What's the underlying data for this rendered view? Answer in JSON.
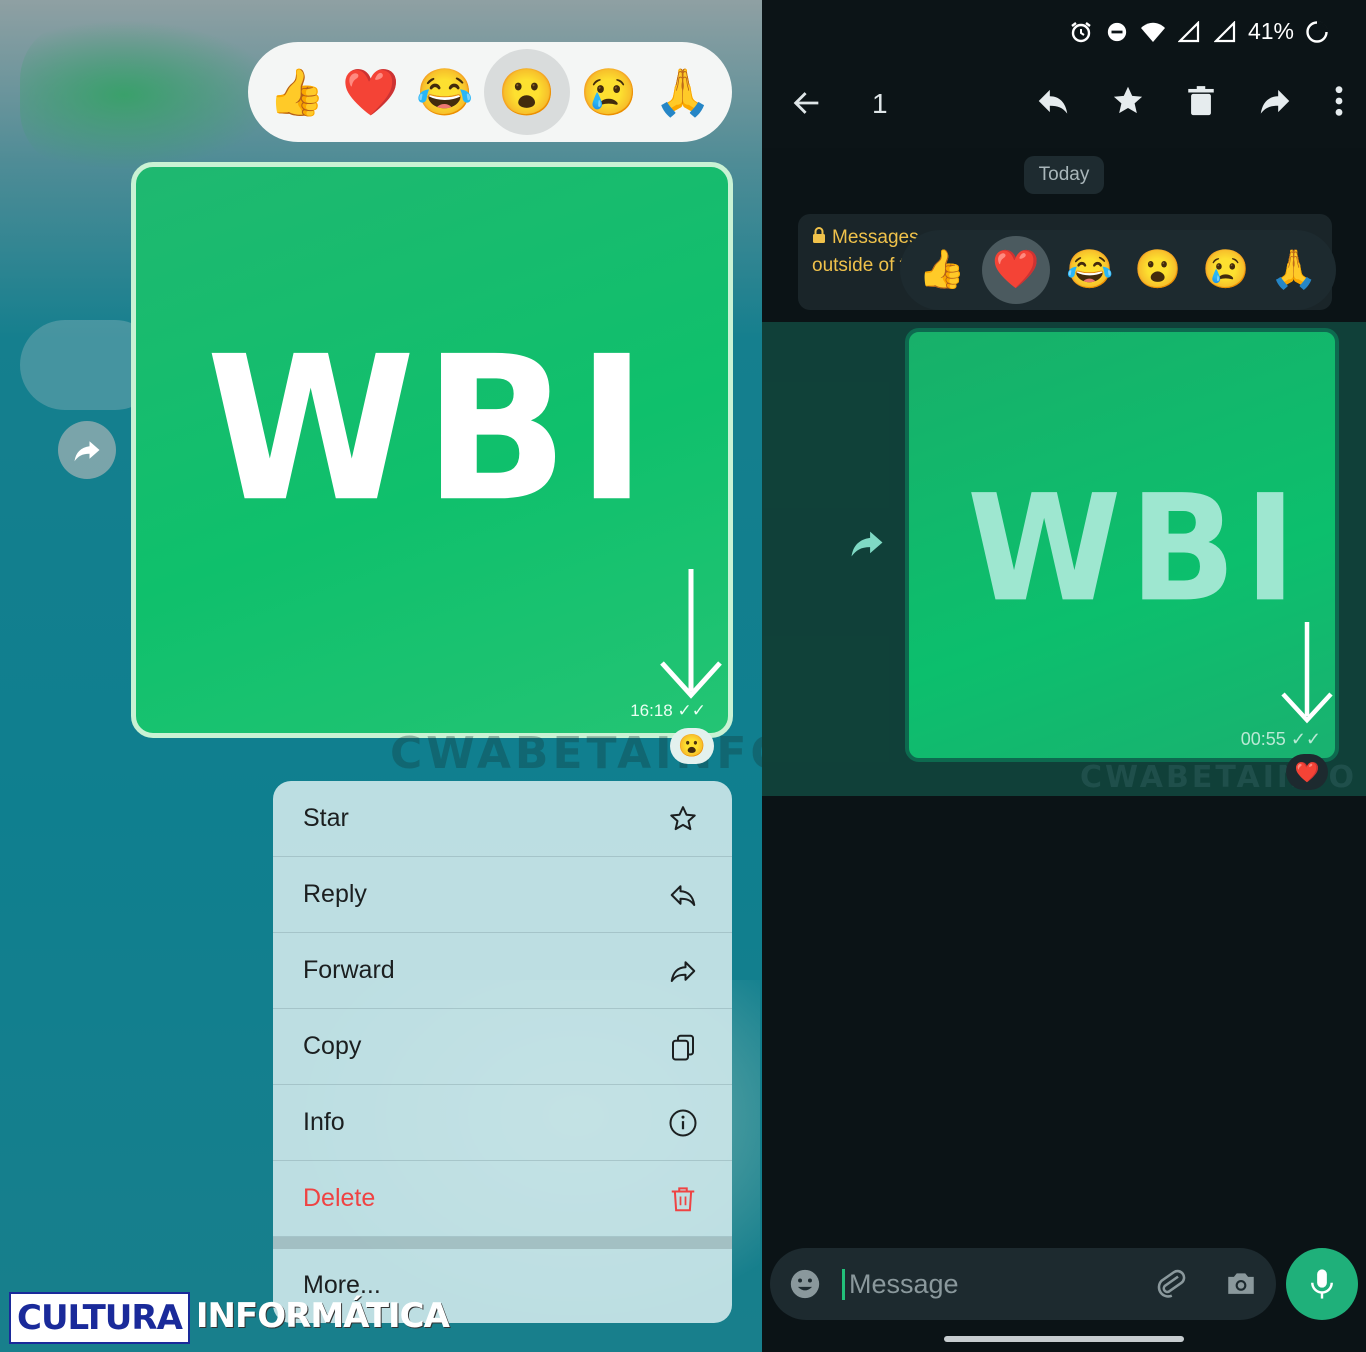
{
  "left": {
    "reactions": [
      {
        "name": "thumbs-up",
        "emoji": "👍",
        "selected": false
      },
      {
        "name": "red-heart",
        "emoji": "❤️",
        "selected": false
      },
      {
        "name": "tears-of-joy",
        "emoji": "😂",
        "selected": false
      },
      {
        "name": "surprised",
        "emoji": "😮",
        "selected": true
      },
      {
        "name": "crying",
        "emoji": "😢",
        "selected": false
      },
      {
        "name": "folded-hands",
        "emoji": "🙏",
        "selected": false
      }
    ],
    "image_logo": "WBI",
    "message_time": "16:18",
    "reaction_badge": "😮",
    "watermark": "CWABETAINFO",
    "menu": {
      "items": [
        {
          "label": "Star",
          "icon": "star-icon"
        },
        {
          "label": "Reply",
          "icon": "reply-icon"
        },
        {
          "label": "Forward",
          "icon": "forward-icon"
        },
        {
          "label": "Copy",
          "icon": "copy-icon"
        },
        {
          "label": "Info",
          "icon": "info-icon"
        },
        {
          "label": "Delete",
          "icon": "trash-icon"
        }
      ],
      "more_label": "More...",
      "delete_color": "#ef4343"
    },
    "site_logo": {
      "part1": "CULTURA",
      "part2": "INFORMÁTICA"
    }
  },
  "right": {
    "status": {
      "battery": "41%"
    },
    "appbar": {
      "selected_count": "1"
    },
    "today_label": "Today",
    "encryption": {
      "line1": "Messages ar",
      "line2": "outside of this"
    },
    "reactions": [
      {
        "name": "thumbs-up",
        "emoji": "👍",
        "selected": false
      },
      {
        "name": "red-heart",
        "emoji": "❤️",
        "selected": true
      },
      {
        "name": "tears-of-joy",
        "emoji": "😂",
        "selected": false
      },
      {
        "name": "surprised",
        "emoji": "😮",
        "selected": false
      },
      {
        "name": "crying",
        "emoji": "😢",
        "selected": false
      },
      {
        "name": "folded-hands",
        "emoji": "🙏",
        "selected": false
      }
    ],
    "image_logo": "WBI",
    "message_time": "00:55",
    "reaction_badge": "❤️",
    "watermark": "CWABETAINFO",
    "composer": {
      "placeholder": "Message"
    },
    "colors": {
      "accent": "#1fb07a",
      "encryption_text": "#f0c24b"
    }
  }
}
